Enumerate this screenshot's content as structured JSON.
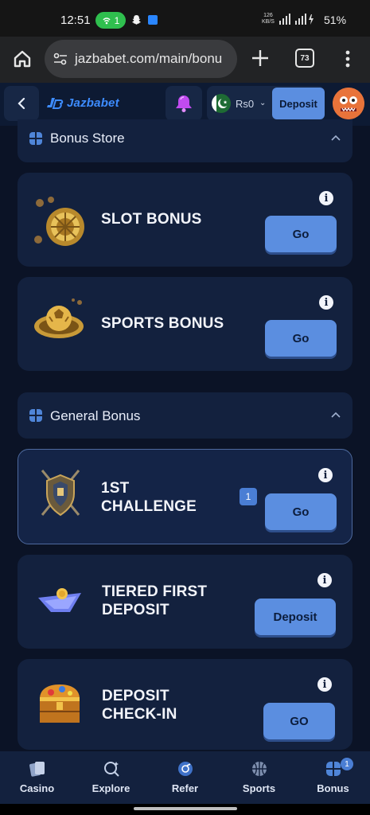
{
  "status_bar": {
    "time": "12:51",
    "hotspot_count": "1",
    "net_speed_value": "126",
    "net_speed_unit": "KB/S",
    "battery": "51%"
  },
  "browser": {
    "url": "jazbabet.com/main/bonu",
    "tab_count": "73"
  },
  "header": {
    "brand": "Jazbabet",
    "balance": "Rs0",
    "deposit_label": "Deposit"
  },
  "sections": {
    "bonus_store": {
      "title": "Bonus Store"
    },
    "general_bonus": {
      "title": "General Bonus"
    }
  },
  "cards": [
    {
      "title_line1": "SLOT BONUS",
      "action": "Go"
    },
    {
      "title_line1": "SPORTS BONUS",
      "action": "Go"
    },
    {
      "title_line1": "1ST",
      "title_line2": "CHALLENGE",
      "action": "Go",
      "count": "1"
    },
    {
      "title_line1": "TIERED FIRST",
      "title_line2": "DEPOSIT",
      "action": "Deposit"
    },
    {
      "title_line1": "DEPOSIT",
      "title_line2": "CHECK-IN",
      "action": "GO"
    }
  ],
  "bottom_nav": [
    {
      "label": "Casino",
      "icon": "cards-icon"
    },
    {
      "label": "Explore",
      "icon": "explore-icon"
    },
    {
      "label": "Refer",
      "icon": "refer-icon"
    },
    {
      "label": "Sports",
      "icon": "basketball-icon"
    },
    {
      "label": "Bonus",
      "icon": "gift-icon",
      "badge": "1"
    }
  ],
  "colors": {
    "background": "#0b1326",
    "card": "#13213e",
    "button": "#5b8ee0",
    "brand": "#3d8cff"
  }
}
